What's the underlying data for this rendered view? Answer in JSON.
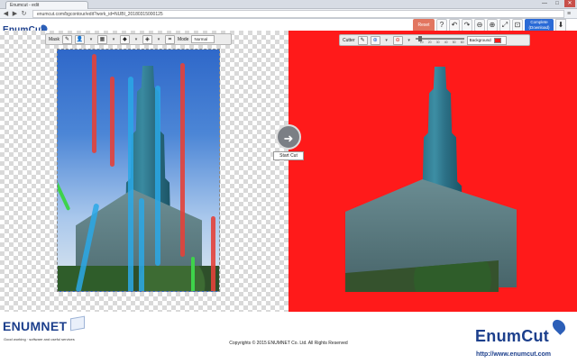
{
  "browser": {
    "tab_title": "Enumcut - edit",
    "url": "enumcut.com/bgcontour/edit?work_id=NUBI_20180315000125",
    "minimize": "—",
    "maximize": "□",
    "close": "✕"
  },
  "app": {
    "logo": "EnumCut",
    "reset_label": "Reset",
    "complete_label": "Complete",
    "complete_sub": "(Download)"
  },
  "mask_toolbar": {
    "mask_label": "Mask",
    "mode_label": "Mode",
    "mode_value": "Normal"
  },
  "cutter_toolbar": {
    "cutter_label": "Cutter",
    "slider_ticks": [
      "",
      "10",
      "20",
      "30",
      "40",
      "50",
      "60"
    ],
    "background_label": "Background"
  },
  "center": {
    "start_cut_label": "Start Cut"
  },
  "footer": {
    "brand_left": "ENUMNET",
    "tagline": "Good working · software and useful services",
    "copyright": "Copyrights © 2015 ENUMNET Co. Ltd. All Rights Reserved",
    "brand_right": "EnumCut",
    "url": "http://www.enumcut.com"
  },
  "colors": {
    "background_fill": "#ff1a1a",
    "brand_blue": "#1c3f8c",
    "reset": "#e27660",
    "complete": "#2a6ad6"
  }
}
